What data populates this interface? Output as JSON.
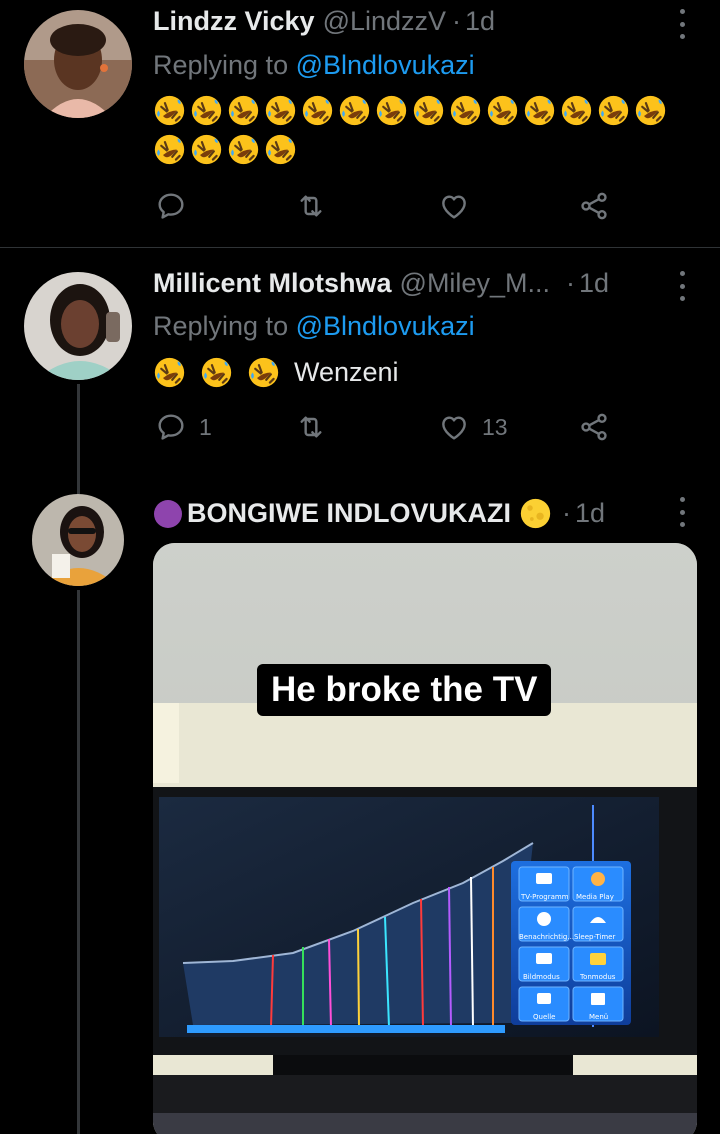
{
  "tweets": [
    {
      "name": "Lindzz Vicky",
      "handle": "@LindzzV",
      "time": "1d",
      "replying_prefix": "Replying to",
      "replying_to": "@Blndlovukazi",
      "emoji": "rolling-on-floor-laughing",
      "emoji_count": 18,
      "text": "",
      "actions": {
        "reply": "",
        "retweet": "",
        "like": ""
      }
    },
    {
      "name": "Millicent Mlotshwa",
      "handle": "@Miley_M...",
      "time": "1d",
      "replying_prefix": "Replying to",
      "replying_to": "@Blndlovukazi",
      "emoji": "rolling-on-floor-laughing",
      "emoji_count": 3,
      "text": "Wenzeni",
      "actions": {
        "reply": "1",
        "retweet": "",
        "like": "13"
      }
    },
    {
      "name": "BONGIWE INDLOVUKAZI",
      "name_prefix_emoji": "purple-circle",
      "name_suffix_emoji": "full-moon",
      "time": "1d",
      "media": {
        "caption": "He broke the TV",
        "tv_menu": [
          "TV-Programm",
          "Media Play",
          "Benachrichtig...",
          "Sleep-Timer",
          "Bildmodus",
          "Tonmodus",
          "Quelle",
          "Menü"
        ]
      }
    }
  ],
  "icons": [
    "reply-icon",
    "retweet-icon",
    "like-icon",
    "share-icon",
    "more-icon"
  ],
  "colors": {
    "background": "#000000",
    "text": "#e7e9ea",
    "muted": "#71767b",
    "link": "#1d9bf0",
    "divider": "#2f3336"
  }
}
